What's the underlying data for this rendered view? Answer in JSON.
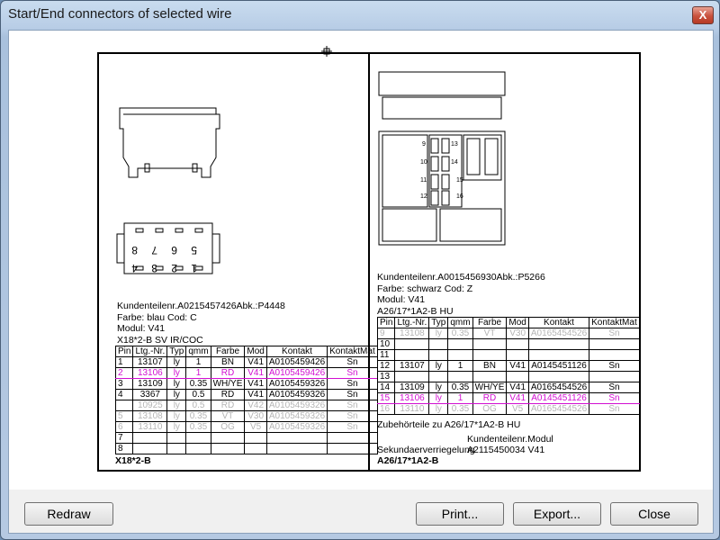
{
  "window": {
    "title": "Start/End connectors of selected wire",
    "close_glyph": "X"
  },
  "buttons": {
    "redraw": "Redraw",
    "print": "Print...",
    "export": "Export...",
    "close": "Close"
  },
  "left": {
    "pin_labels_top": [
      "8",
      "7",
      "6",
      "5"
    ],
    "pin_labels_bottom": [
      "4",
      "3",
      "2",
      "1"
    ],
    "info": [
      "Kundenteilenr.A0215457426Abk.:P4448",
      "Farbe: blau Cod: C",
      "Modul: V41",
      "X18*2-B SV IR/COC"
    ],
    "headers": [
      "Pin",
      "Ltg.-Nr.",
      "Typ",
      "qmm",
      "Farbe",
      "Mod",
      "Kontakt",
      "KontaktMat"
    ],
    "rows": [
      {
        "state": "normal",
        "cells": [
          "1",
          "13107",
          "ly",
          "1",
          "BN",
          "V41",
          "A0105459426",
          "Sn"
        ]
      },
      {
        "state": "sel",
        "cells": [
          "2",
          "13106",
          "ly",
          "1",
          "RD",
          "V41",
          "A0105459426",
          "Sn"
        ]
      },
      {
        "state": "normal",
        "cells": [
          "3",
          "13109",
          "ly",
          "0.35",
          "WH/YE",
          "V41",
          "A0105459326",
          "Sn"
        ]
      },
      {
        "state": "normal",
        "cells": [
          "4",
          "3367",
          "ly",
          "0.5",
          "RD",
          "V41",
          "A0105459326",
          "Sn"
        ]
      },
      {
        "state": "grey",
        "cells": [
          "",
          "10925",
          "ly",
          "0.5",
          "RD",
          "V42",
          "A0105459326",
          "Sn"
        ]
      },
      {
        "state": "grey",
        "cells": [
          "5",
          "13108",
          "ly",
          "0.35",
          "VT",
          "V30",
          "A0105459326",
          "Sn"
        ]
      },
      {
        "state": "grey",
        "cells": [
          "6",
          "13110",
          "ly",
          "0.35",
          "OG",
          "V5",
          "A0105459326",
          "Sn"
        ]
      },
      {
        "state": "normal",
        "cells": [
          "7",
          "",
          "",
          "",
          "",
          "",
          "",
          ""
        ]
      },
      {
        "state": "normal",
        "cells": [
          "8",
          "",
          "",
          "",
          "",
          "",
          "",
          ""
        ]
      }
    ],
    "footer": "X18*2-B"
  },
  "right": {
    "cavity_labels": [
      "9",
      "10",
      "11",
      "12",
      "13",
      "14",
      "15",
      "16"
    ],
    "info": [
      "Kundenteilenr.A0015456930Abk.:P5266",
      "Farbe: schwarz Cod: Z",
      "Modul: V41",
      "A26/17*1A2-B HU"
    ],
    "headers": [
      "Pin",
      "Ltg.-Nr.",
      "Typ",
      "qmm",
      "Farbe",
      "Mod",
      "Kontakt",
      "KontaktMat"
    ],
    "rows": [
      {
        "state": "grey",
        "cells": [
          "9",
          "13108",
          "ly",
          "0.35",
          "VT",
          "V30",
          "A0165454526",
          "Sn"
        ]
      },
      {
        "state": "normal",
        "cells": [
          "10",
          "",
          "",
          "",
          "",
          "",
          "",
          ""
        ]
      },
      {
        "state": "normal",
        "cells": [
          "11",
          "",
          "",
          "",
          "",
          "",
          "",
          ""
        ]
      },
      {
        "state": "normal",
        "cells": [
          "12",
          "13107",
          "ly",
          "1",
          "BN",
          "V41",
          "A0145451126",
          "Sn"
        ]
      },
      {
        "state": "normal",
        "cells": [
          "13",
          "",
          "",
          "",
          "",
          "",
          "",
          ""
        ]
      },
      {
        "state": "normal",
        "cells": [
          "14",
          "13109",
          "ly",
          "0.35",
          "WH/YE",
          "V41",
          "A0165454526",
          "Sn"
        ]
      },
      {
        "state": "sel",
        "cells": [
          "15",
          "13106",
          "ly",
          "1",
          "RD",
          "V41",
          "A0145451126",
          "Sn"
        ]
      },
      {
        "state": "grey",
        "cells": [
          "16",
          "13110",
          "ly",
          "0.35",
          "OG",
          "V5",
          "A0165454526",
          "Sn"
        ]
      }
    ],
    "zubehoer_title": "Zubehörteile zu A26/17*1A2-B HU",
    "zubehoer_header": "Kundenteilenr.Modul",
    "zubehoer_row_label": "Sekundaerverriegelung",
    "zubehoer_row_value": "A2115450034 V41",
    "footer": "A26/17*1A2-B"
  },
  "colors": {
    "selected": "#d10fd1",
    "grey": "#b5b5b5",
    "close_red": "#c8513d"
  }
}
